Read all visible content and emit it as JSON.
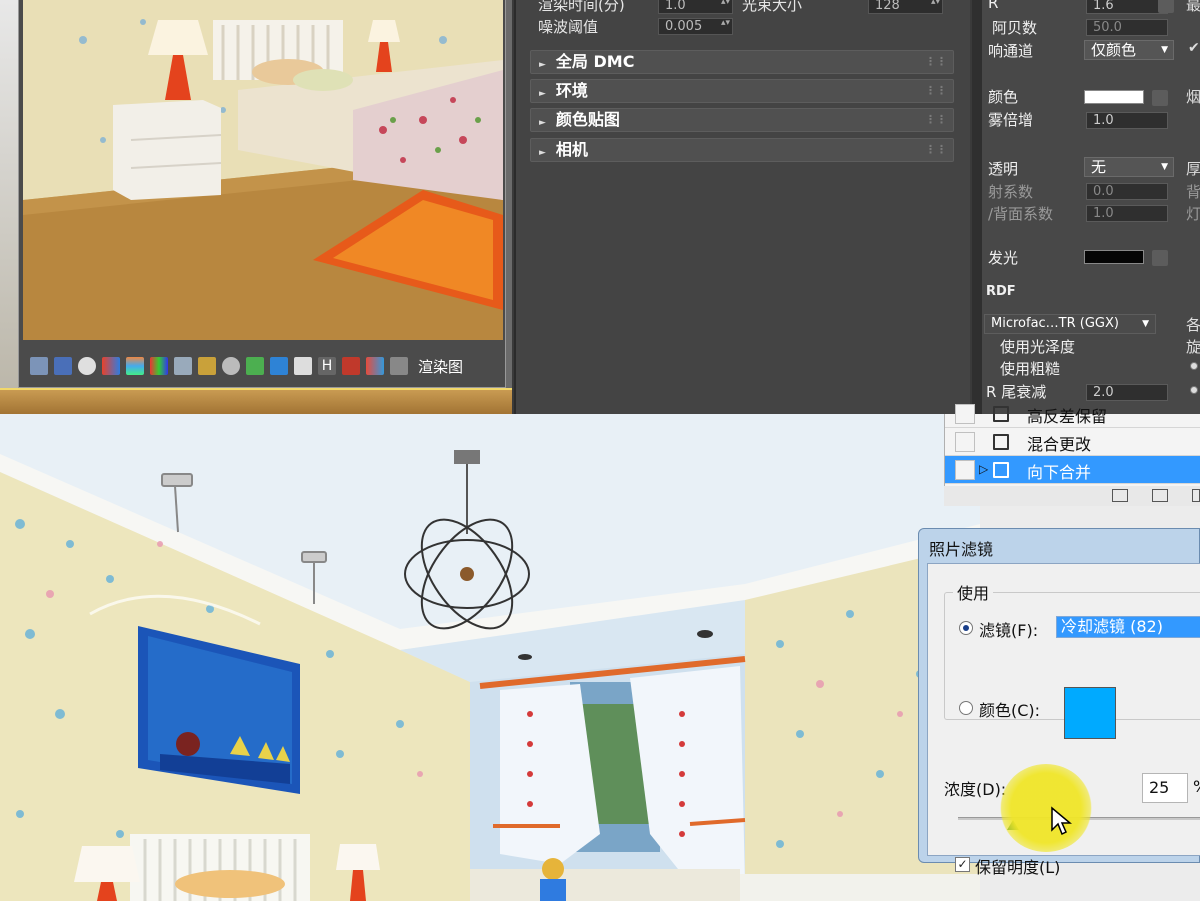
{
  "render_settings": {
    "rows": [
      {
        "label": "渲染时间(分)",
        "value": "1.0",
        "extra_label": "光束大小",
        "extra_value": "128"
      },
      {
        "label": "噪波阈值",
        "value": "0.005"
      }
    ],
    "rollouts": [
      "全局 DMC",
      "环境",
      "颜色贴图",
      "相机"
    ]
  },
  "vfb": {
    "toolbar_label": "渲染图"
  },
  "material_editor": {
    "rows": [
      {
        "label": "R",
        "value": "1.6",
        "right": "最"
      },
      {
        "label": "阿贝数",
        "value": "50.0"
      },
      {
        "label": "响通道",
        "dropdown": "仅颜色"
      },
      {
        "label": "颜色",
        "right": "烟"
      },
      {
        "label": "雾倍增",
        "value": "1.0"
      },
      {
        "label": "透明",
        "dropdown": "无",
        "right": "厚"
      },
      {
        "label": "射系数",
        "value": "0.0",
        "right": "背"
      },
      {
        "label": "/背面系数",
        "value": "1.0",
        "right": "灯"
      },
      {
        "label": "发光"
      },
      {
        "label": "RDF"
      },
      {
        "label": "Microfac…TR (GGX)",
        "right": "各"
      },
      {
        "label": "使用光泽度",
        "right": "旋"
      },
      {
        "label": "使用粗糙"
      },
      {
        "label": "R 尾衰减",
        "value": "2.0"
      }
    ]
  },
  "layers_panel": {
    "layers": [
      {
        "name": "高反差保留",
        "selected": false
      },
      {
        "name": "混合更改",
        "selected": false
      },
      {
        "name": "向下合并",
        "selected": true
      }
    ]
  },
  "photo_filter": {
    "title": "照片滤镜",
    "use_group": "使用",
    "filter_label": "滤镜(F):",
    "filter_value": "冷却滤镜 (82)",
    "color_label": "颜色(C):",
    "color_value": "#00aaff",
    "density_label": "浓度(D):",
    "density_value": "25",
    "density_unit": "%",
    "density_fraction": 0.25,
    "preserve_label": "保留明度(L)",
    "preserve_checked": true,
    "filter_selected": true
  }
}
